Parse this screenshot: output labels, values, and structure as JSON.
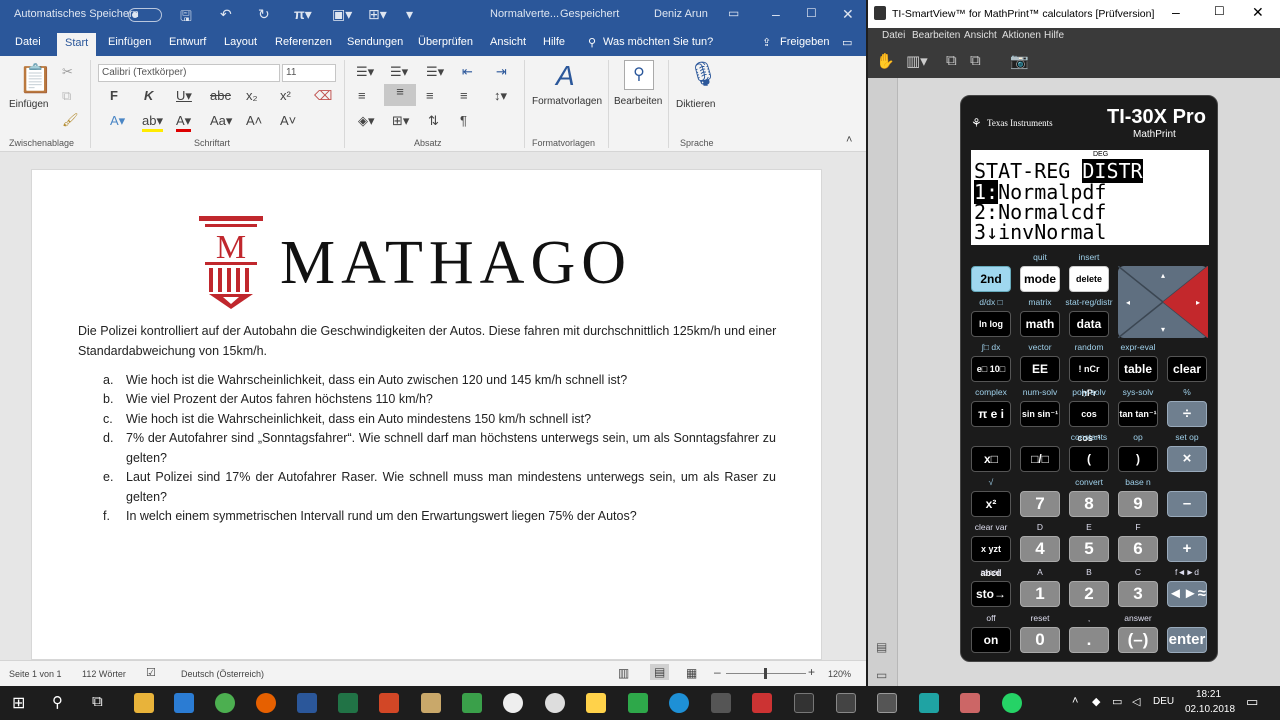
{
  "word": {
    "autosave": "Automatisches Speichern",
    "doc_title": "Normalverte...",
    "saved": "Gespeichert",
    "user": "Deniz Arun",
    "tabs": [
      "Datei",
      "Start",
      "Einfügen",
      "Entwurf",
      "Layout",
      "Referenzen",
      "Sendungen",
      "Überprüfen",
      "Ansicht",
      "Hilfe"
    ],
    "tell_me": "Was möchten Sie tun?",
    "share": "Freigeben",
    "font_name": "Calibri (Textkörper)",
    "font_size": "11",
    "groups": {
      "clipboard": "Zwischenablage",
      "font": "Schriftart",
      "paragraph": "Absatz",
      "styles": "Formatvorlagen",
      "voice": "Sprache"
    },
    "buttons": {
      "paste": "Einfügen",
      "styles": "Formatvorlagen",
      "edit": "Bearbeiten",
      "dictate": "Diktieren"
    },
    "logo_text": "MATHAGO",
    "intro": "Die Polizei kontrolliert auf der Autobahn die Geschwindigkeiten der Autos. Diese fahren mit durchschnittlich 125km/h und einer Standardabweichung von 15km/h.",
    "questions": [
      {
        "label": "a.",
        "text": "Wie hoch ist die Wahrscheinlichkeit, dass ein Auto zwischen 120 und 145 km/h schnell ist?"
      },
      {
        "label": "b.",
        "text": "Wie viel Prozent der Autos fahren höchstens 110 km/h?"
      },
      {
        "label": "c.",
        "text": "Wie hoch ist die Wahrscheinlichkeit, dass ein Auto mindestens 150 km/h schnell ist?"
      },
      {
        "label": "d.",
        "text": "7% der Autofahrer sind „Sonntagsfahrer“. Wie schnell darf man höchstens unterwegs sein, um als Sonntagsfahrer zu gelten?"
      },
      {
        "label": "e.",
        "text": "Laut Polizei sind 17% der Autofahrer Raser. Wie schnell muss man mindestens unterwegs sein, um als Raser zu gelten?"
      },
      {
        "label": "f.",
        "text": "In welch einem symmetrischen Intervall rund um den Erwartungswert liegen 75% der Autos?"
      }
    ],
    "status": {
      "page": "Seite 1 von 1",
      "words": "112 Wörter",
      "lang": "Deutsch (Österreich)",
      "zoom": "120%"
    }
  },
  "ti": {
    "title": "TI-SmartView™ for MathPrint™ calculators [Prüfversion]",
    "menu": [
      "Datei",
      "Bearbeiten",
      "Ansicht",
      "Aktionen",
      "Hilfe"
    ],
    "brand": "Texas Instruments",
    "model": "TI-30X Pro",
    "model_sub": "MathPrint",
    "screen": {
      "mode": "DEG",
      "line1a": "STAT-REG ",
      "line1b": "DISTR",
      "line2a": "1:",
      "line2b": "Normalpdf",
      "line3": "2:Normalcdf",
      "line4": "3↓invNormal"
    },
    "keys": [
      {
        "sec": "",
        "label": "2nd",
        "cls": "bl"
      },
      {
        "sec": "quit",
        "label": "mode",
        "cls": "w"
      },
      {
        "sec": "insert",
        "label": "delete",
        "cls": "w"
      },
      {
        "sec": "d/dx □",
        "label": "ln log",
        "cls": ""
      },
      {
        "sec": "matrix",
        "label": "math",
        "cls": ""
      },
      {
        "sec": "stat-reg/distr",
        "label": "data",
        "cls": ""
      },
      {
        "sec": "∫□ dx",
        "label": "e□ 10□",
        "cls": ""
      },
      {
        "sec": "vector",
        "label": "EE",
        "cls": ""
      },
      {
        "sec": "random",
        "label": "! nCr nPr",
        "cls": ""
      },
      {
        "sec": "expr-eval",
        "label": "table",
        "cls": ""
      },
      {
        "sec": "",
        "label": "clear",
        "cls": ""
      },
      {
        "sec": "complex",
        "label": "π e i",
        "cls": ""
      },
      {
        "sec": "num-solv",
        "label": "sin sin⁻¹",
        "cls": ""
      },
      {
        "sec": "poly-solv",
        "label": "cos cos⁻¹",
        "cls": ""
      },
      {
        "sec": "sys-solv",
        "label": "tan tan⁻¹",
        "cls": ""
      },
      {
        "sec": "%",
        "label": "÷",
        "cls": "op"
      },
      {
        "sec": "",
        "label": "x□",
        "cls": ""
      },
      {
        "sec": "",
        "label": "□/□",
        "cls": ""
      },
      {
        "sec": "constants",
        "label": "(",
        "cls": ""
      },
      {
        "sec": "op",
        "label": ")",
        "cls": ""
      },
      {
        "sec": "set op",
        "label": "×",
        "cls": "op"
      },
      {
        "sec": "√",
        "label": "x²",
        "cls": ""
      },
      {
        "sec": "",
        "label": "7",
        "cls": "num"
      },
      {
        "sec": "convert",
        "label": "8",
        "cls": "num"
      },
      {
        "sec": "base n",
        "label": "9",
        "cls": "num"
      },
      {
        "sec": "",
        "label": "–",
        "cls": "op"
      },
      {
        "sec": "clear var",
        "label": "x yzt abcd",
        "cls": ""
      },
      {
        "sec": "D",
        "label": "4",
        "cls": "num"
      },
      {
        "sec": "E",
        "label": "5",
        "cls": "num"
      },
      {
        "sec": "F",
        "label": "6",
        "cls": "num"
      },
      {
        "sec": "",
        "label": "+",
        "cls": "op"
      },
      {
        "sec": "recall",
        "label": "sto→",
        "cls": ""
      },
      {
        "sec": "A",
        "label": "1",
        "cls": "num"
      },
      {
        "sec": "B",
        "label": "2",
        "cls": "num"
      },
      {
        "sec": "C",
        "label": "3",
        "cls": "num"
      },
      {
        "sec": "f◄►d",
        "label": "◄►≈",
        "cls": "op"
      },
      {
        "sec": "off",
        "label": "on",
        "cls": ""
      },
      {
        "sec": "reset",
        "label": "0",
        "cls": "num"
      },
      {
        "sec": ",",
        "label": ".",
        "cls": "num"
      },
      {
        "sec": "answer",
        "label": "(–)",
        "cls": "num"
      },
      {
        "sec": "",
        "label": "enter",
        "cls": "op"
      }
    ]
  },
  "taskbar": {
    "lang": "DEU",
    "time": "18:21",
    "date": "02.10.2018"
  },
  "colors": {
    "word_blue": "#2b579a",
    "logo_red": "#c0272d",
    "calc_body": "#1b1b1b",
    "key_blue": "#9fd7ef"
  }
}
